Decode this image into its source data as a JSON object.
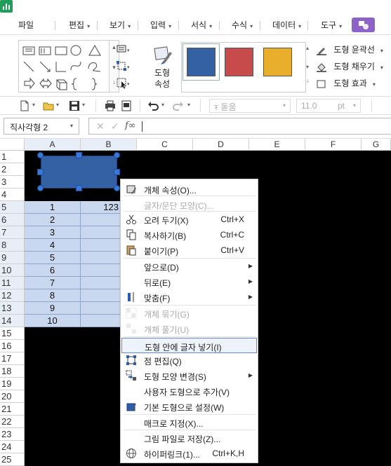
{
  "menubar": {
    "items": [
      {
        "label": "파일",
        "caret": ""
      },
      {
        "label": "편집",
        "caret": "▾"
      },
      {
        "label": "보기",
        "caret": "▾"
      },
      {
        "label": "입력",
        "caret": "▾"
      },
      {
        "label": "서식",
        "caret": "▾"
      },
      {
        "label": "수식",
        "caret": "▾"
      },
      {
        "label": "데이터",
        "caret": "▾"
      },
      {
        "label": "도구",
        "caret": "▾"
      }
    ]
  },
  "ribbon": {
    "shape_properties_label_1": "도형",
    "shape_properties_label_2": "속성",
    "style_colors": [
      "#3461a3",
      "#c84b4b",
      "#e8ae2c"
    ],
    "outline_label": "도형 윤곽선",
    "fill_label": "도형 채우기",
    "effect_label": "도형 효과"
  },
  "toolbar2": {
    "font_name": "돋움",
    "font_size": "11.0",
    "font_unit": "pt"
  },
  "formula": {
    "name_box": "직사각형 2",
    "fx_label": "f∞",
    "cancel_icon": "✕",
    "confirm_icon": "✓"
  },
  "sheet": {
    "columns": [
      "A",
      "B",
      "C",
      "D",
      "E",
      "F",
      "G"
    ],
    "rows": [
      "1",
      "2",
      "3",
      "4",
      "5",
      "6",
      "7",
      "8",
      "9",
      "10",
      "11",
      "12",
      "13",
      "14",
      "15",
      "16",
      "17",
      "18",
      "19",
      "20",
      "21",
      "22",
      "23",
      "24",
      "25"
    ],
    "col_a_values": [
      "1",
      "2",
      "3",
      "4",
      "5",
      "6",
      "7",
      "8",
      "9",
      "10"
    ],
    "b5_value": "123"
  },
  "context_menu": {
    "items": [
      {
        "label": "개체 속성(O)...",
        "shortcut": "",
        "submenu": false,
        "disabled": false,
        "icon": "object-properties-icon"
      },
      {
        "label": "글자/문단 모양(C)...",
        "shortcut": "",
        "submenu": false,
        "disabled": true,
        "icon": ""
      },
      {
        "label": "오려 두기(X)",
        "shortcut": "Ctrl+X",
        "submenu": false,
        "disabled": false,
        "icon": "scissors-icon"
      },
      {
        "label": "복사하기(B)",
        "shortcut": "Ctrl+C",
        "submenu": false,
        "disabled": false,
        "icon": "copy-icon"
      },
      {
        "label": "붙이기(P)",
        "shortcut": "Ctrl+V",
        "submenu": false,
        "disabled": false,
        "icon": "paste-icon"
      },
      {
        "label": "앞으로(D)",
        "shortcut": "",
        "submenu": true,
        "disabled": false,
        "icon": ""
      },
      {
        "label": "뒤로(E)",
        "shortcut": "",
        "submenu": true,
        "disabled": false,
        "icon": ""
      },
      {
        "label": "맞춤(F)",
        "shortcut": "",
        "submenu": true,
        "disabled": false,
        "icon": "align-icon"
      },
      {
        "label": "개체 묶기(G)",
        "shortcut": "",
        "submenu": false,
        "disabled": true,
        "icon": "group-icon"
      },
      {
        "label": "개체 풀기(U)",
        "shortcut": "",
        "submenu": false,
        "disabled": true,
        "icon": "ungroup-icon"
      },
      {
        "label": "도형 안에 글자 넣기(I)",
        "shortcut": "",
        "submenu": false,
        "disabled": false,
        "icon": ""
      },
      {
        "label": "점 편집(Q)",
        "shortcut": "",
        "submenu": false,
        "disabled": false,
        "icon": "edit-points-icon"
      },
      {
        "label": "도형 모양 변경(S)",
        "shortcut": "",
        "submenu": true,
        "disabled": false,
        "icon": "change-shape-icon"
      },
      {
        "label": "사용자 도형으로 추가(V)",
        "shortcut": "",
        "submenu": false,
        "disabled": false,
        "icon": ""
      },
      {
        "label": "기본 도형으로 설정(W)",
        "shortcut": "",
        "submenu": false,
        "disabled": false,
        "icon": "default-shape-icon"
      },
      {
        "label": "매크로 지정(X)...",
        "shortcut": "",
        "submenu": false,
        "disabled": false,
        "icon": ""
      },
      {
        "label": "그림 파일로 저장(Z)...",
        "shortcut": "",
        "submenu": false,
        "disabled": false,
        "icon": ""
      },
      {
        "label": "하이퍼링크(1)...",
        "shortcut": "Ctrl+K,H",
        "submenu": false,
        "disabled": false,
        "icon": "hyperlink-icon"
      }
    ],
    "highlighted_index": 10
  }
}
